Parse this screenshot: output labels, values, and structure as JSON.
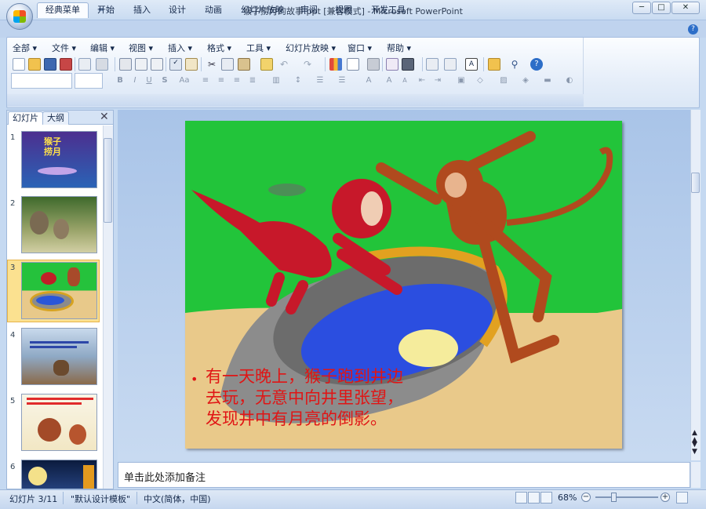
{
  "window": {
    "title": "猴子捞月的故事.ppt [兼容模式] - Microsoft PowerPoint",
    "minimize": "─",
    "maximize": "□",
    "close": "✕"
  },
  "quick_access": {
    "customize": "="
  },
  "ribbon_tabs": [
    {
      "label": "经典菜单",
      "active": true
    },
    {
      "label": "开始"
    },
    {
      "label": "插入"
    },
    {
      "label": "设计"
    },
    {
      "label": "动画"
    },
    {
      "label": "幻灯片放映"
    },
    {
      "label": "审阅"
    },
    {
      "label": "视图"
    },
    {
      "label": "开发工具"
    }
  ],
  "classic_menu": [
    "全部 ▾",
    "文件 ▾",
    "编辑 ▾",
    "视图 ▾",
    "插入 ▾",
    "格式 ▾",
    "工具 ▾",
    "幻灯片放映 ▾",
    "窗口 ▾",
    "帮助 ▾"
  ],
  "panel_tabs": {
    "slides": "幻灯片",
    "outline": "大纲",
    "close": "✕"
  },
  "thumbnails": [
    {
      "num": "1",
      "text": "猴子\n捞月"
    },
    {
      "num": "2",
      "text": ""
    },
    {
      "num": "3",
      "text": "",
      "selected": true
    },
    {
      "num": "4",
      "text": ""
    },
    {
      "num": "5",
      "text": ""
    },
    {
      "num": "6",
      "text": ""
    }
  ],
  "slide": {
    "bullet": "•",
    "text": "有一天晚上，猴子跑到井边\n去玩，无意中向井里张望，\n发现井中有月亮的倒影。"
  },
  "notes_placeholder": "单击此处添加备注",
  "status": {
    "slide_info": "幻灯片 3/11",
    "theme": "\"默认设计模板\"",
    "language": "中文(简体，中国)",
    "zoom": "68%",
    "zoom_minus": "−",
    "zoom_plus": "+"
  },
  "colors": {
    "bullet_red": "#e01515",
    "selection": "#fbe190",
    "sky": "#22c43a"
  }
}
